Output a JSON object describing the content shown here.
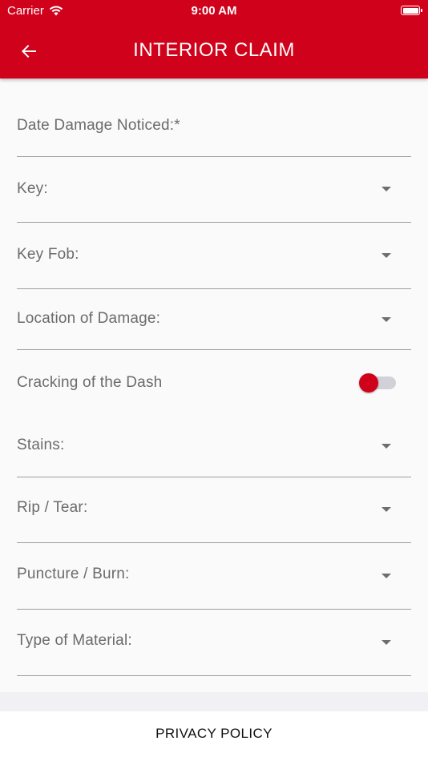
{
  "status_bar": {
    "carrier": "Carrier",
    "time": "9:00 AM"
  },
  "header": {
    "title": "INTERIOR CLAIM",
    "back_icon": "arrow-left-icon"
  },
  "form": {
    "date_label": "Date Damage Noticed:*",
    "key_label": "Key:",
    "key_fob_label": "Key Fob:",
    "location_label": "Location of Damage:",
    "dash_label": "Cracking of the Dash",
    "dash_toggle_on": false,
    "stains_label": "Stains:",
    "rip_label": "Rip / Tear:",
    "puncture_label": "Puncture / Burn:",
    "material_label": "Type of Material:"
  },
  "footer": {
    "privacy_label": "PRIVACY POLICY"
  },
  "colors": {
    "brand": "#d0021b",
    "background": "#fafafa"
  }
}
